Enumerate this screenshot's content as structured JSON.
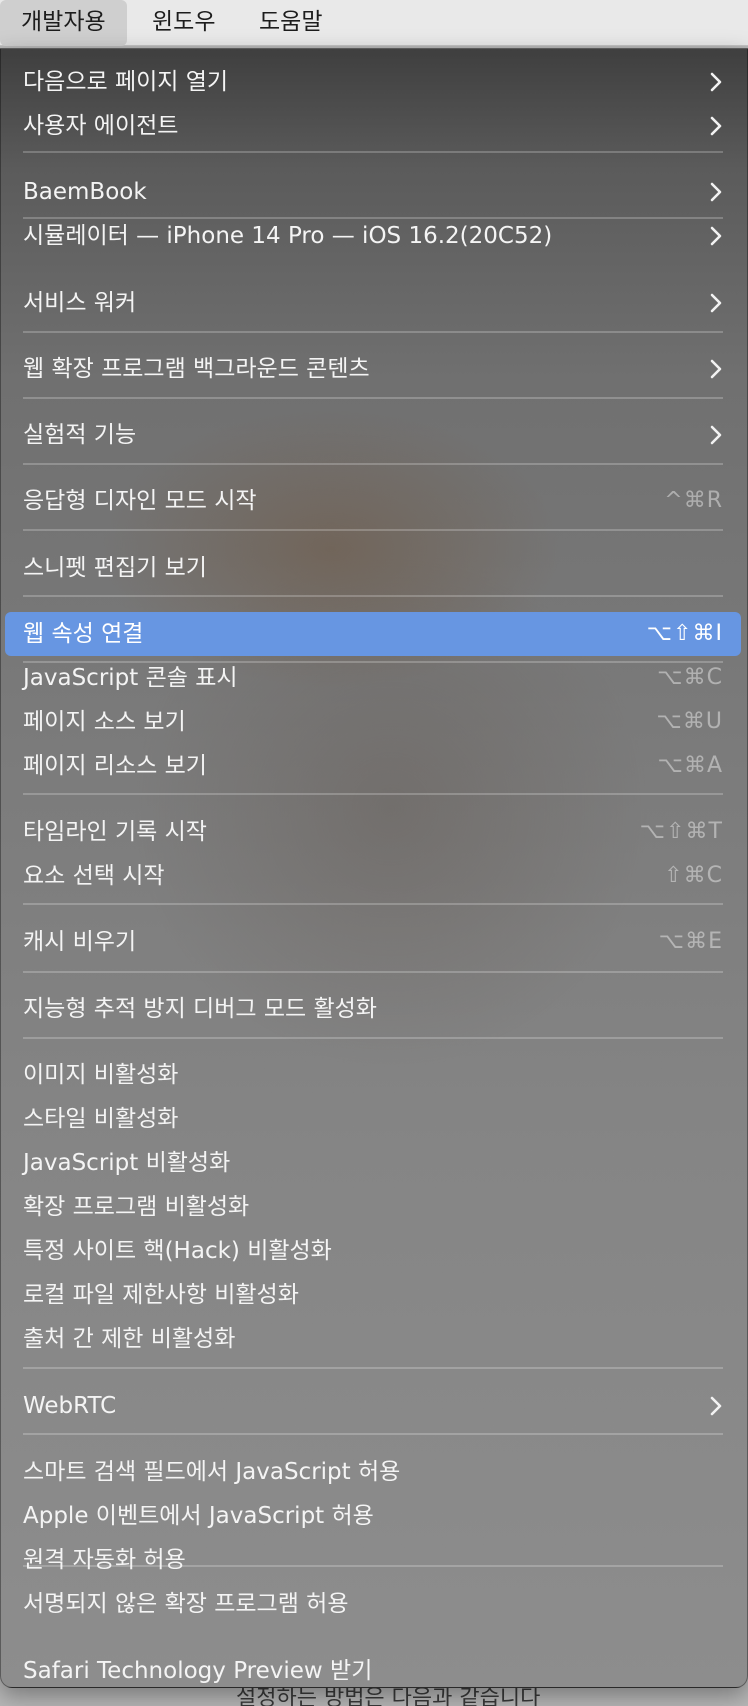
{
  "menubar": {
    "items": [
      "개발자용",
      "윈도우",
      "도움말"
    ],
    "active": "개발자용"
  },
  "background_text": "설정하는 방법은 다음과 같습니다",
  "menu": {
    "highlight_color": "#6796e2",
    "items": [
      {
        "label": "다음으로 페이지 열기",
        "submenu": true
      },
      {
        "label": "사용자 에이전트",
        "submenu": true
      },
      {
        "label": "BaemBook",
        "submenu": true
      },
      {
        "label": "시뮬레이터 — iPhone 14 Pro — iOS 16.2(20C52)",
        "submenu": true
      },
      {
        "label": "서비스 워커",
        "submenu": true
      },
      {
        "label": "웹 확장 프로그램 백그라운드 콘텐츠",
        "submenu": true
      },
      {
        "label": "실험적 기능",
        "submenu": true
      },
      {
        "label": "응답형 디자인 모드 시작",
        "shortcut": "^⌘R"
      },
      {
        "label": "스니펫 편집기 보기"
      },
      {
        "label": "웹 속성 연결",
        "shortcut": "⌥⇧⌘I",
        "highlighted": true
      },
      {
        "label": "JavaScript 콘솔 표시",
        "shortcut": "⌥⌘C"
      },
      {
        "label": "페이지 소스 보기",
        "shortcut": "⌥⌘U"
      },
      {
        "label": "페이지 리소스 보기",
        "shortcut": "⌥⌘A"
      },
      {
        "label": "타임라인 기록 시작",
        "shortcut": "⌥⇧⌘T"
      },
      {
        "label": "요소 선택 시작",
        "shortcut": "⇧⌘C"
      },
      {
        "label": "캐시 비우기",
        "shortcut": "⌥⌘E"
      },
      {
        "label": "지능형 추적 방지 디버그 모드 활성화"
      },
      {
        "label": "이미지 비활성화"
      },
      {
        "label": "스타일 비활성화"
      },
      {
        "label": "JavaScript 비활성화"
      },
      {
        "label": "확장 프로그램 비활성화"
      },
      {
        "label": "특정 사이트 핵(Hack) 비활성화"
      },
      {
        "label": "로컬 파일 제한사항 비활성화"
      },
      {
        "label": "출처 간 제한 비활성화"
      },
      {
        "label": "WebRTC",
        "submenu": true
      },
      {
        "label": "스마트 검색 필드에서 JavaScript 허용"
      },
      {
        "label": "Apple 이벤트에서 JavaScript 허용"
      },
      {
        "label": "원격 자동화 허용"
      },
      {
        "label": "서명되지 않은 확장 프로그램 허용"
      },
      {
        "label": "Safari Technology Preview 받기"
      }
    ]
  }
}
